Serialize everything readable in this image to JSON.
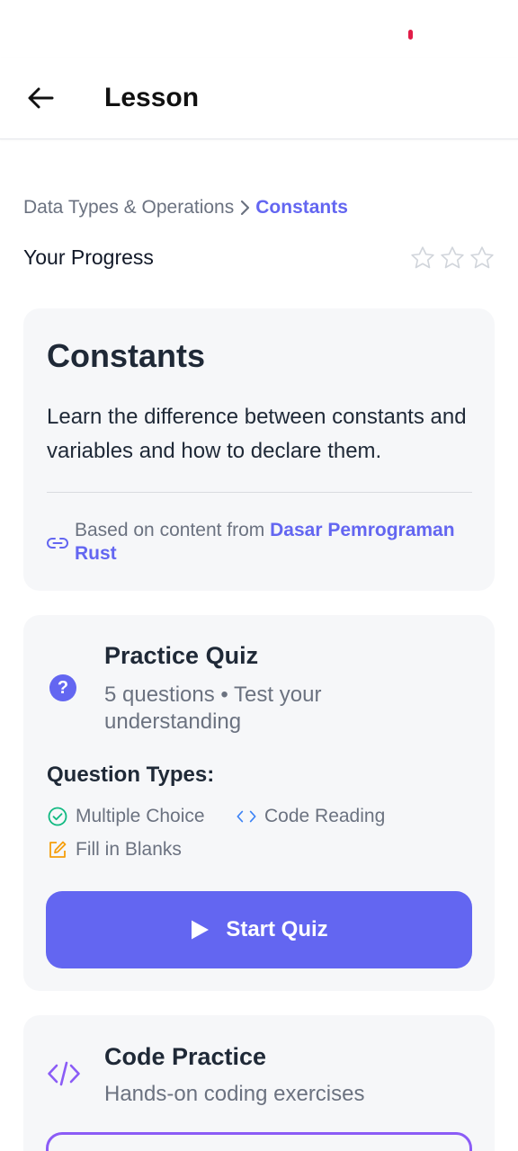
{
  "app_bar": {
    "title": "Lesson"
  },
  "breadcrumb": {
    "parent": "Data Types & Operations",
    "current": "Constants"
  },
  "progress": {
    "label": "Your Progress",
    "stars_filled": 0,
    "stars_total": 3
  },
  "lesson": {
    "title": "Constants",
    "description": "Learn the difference between constants and variables and how to declare them.",
    "source_prefix": "Based on content from",
    "source_link": "Dasar Pemrograman Rust"
  },
  "quiz": {
    "title": "Practice Quiz",
    "subtitle": "5 questions • Test your understanding",
    "types_title": "Question Types:",
    "types": [
      "Multiple Choice",
      "Code Reading",
      "Fill in Blanks"
    ],
    "start_label": "Start Quiz"
  },
  "code_practice": {
    "title": "Code Practice",
    "subtitle": "Hands-on coding exercises"
  },
  "colors": {
    "accent": "#6366f1",
    "code_accent": "#8b5cf6",
    "check_green": "#10b981",
    "edit_orange": "#f59e0b",
    "code_blue": "#3b82f6"
  }
}
